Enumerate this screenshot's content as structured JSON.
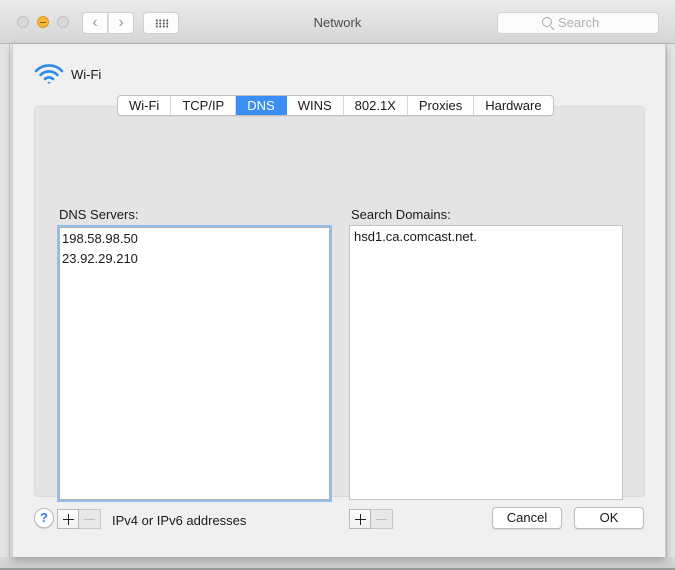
{
  "window": {
    "title": "Network",
    "search_placeholder": "Search",
    "nav": {
      "back": "‹",
      "forward": "›"
    }
  },
  "sheet": {
    "interface_name": "Wi-Fi",
    "tabs": [
      {
        "label": "Wi-Fi",
        "active": false
      },
      {
        "label": "TCP/IP",
        "active": false
      },
      {
        "label": "DNS",
        "active": true
      },
      {
        "label": "WINS",
        "active": false
      },
      {
        "label": "802.1X",
        "active": false
      },
      {
        "label": "Proxies",
        "active": false
      },
      {
        "label": "Hardware",
        "active": false
      }
    ],
    "dns_servers": {
      "label": "DNS Servers:",
      "items": [
        "198.58.98.50",
        "23.92.29.210"
      ],
      "hint": "IPv4 or IPv6 addresses"
    },
    "search_domains": {
      "label": "Search Domains:",
      "items": [
        "hsd1.ca.comcast.net."
      ]
    },
    "help": "?",
    "cancel_label": "Cancel",
    "ok_label": "OK"
  },
  "colors": {
    "accent": "#3a8ef5",
    "focus_ring": "#93bdec",
    "wifi_icon": "#2f8ae8",
    "minimize": "#f5b73a"
  }
}
